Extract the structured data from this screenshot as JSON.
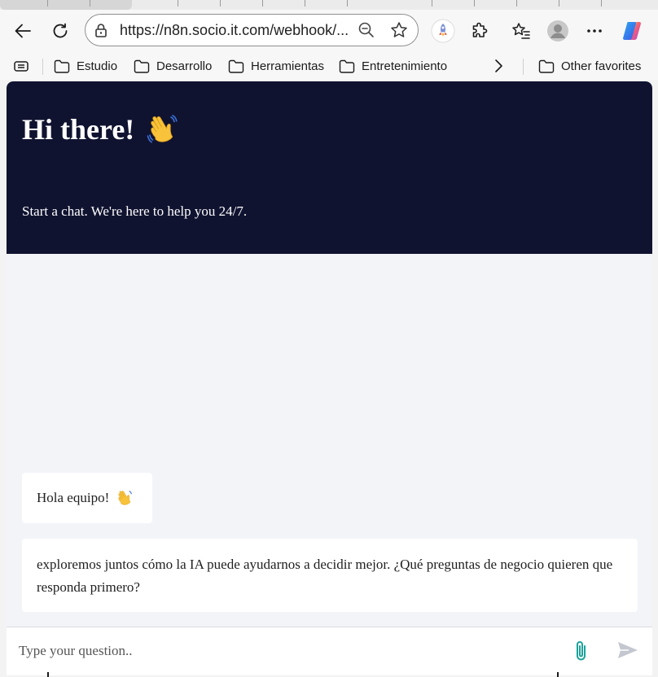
{
  "browser": {
    "address_url": "https://n8n.socio.it.com/webhook/...",
    "favorites": [
      {
        "label": "Estudio"
      },
      {
        "label": "Desarrollo"
      },
      {
        "label": "Herramientas"
      },
      {
        "label": "Entretenimiento"
      }
    ],
    "other_favorites": "Other favorites"
  },
  "chat": {
    "title": "Hi there!",
    "title_emoji": "👋",
    "subtitle": "Start a chat. We're here to help you 24/7.",
    "messages": [
      {
        "text": "Hola equipo!",
        "emoji": "👋"
      },
      {
        "text": "exploremos juntos cómo la IA puede ayudarnos a decidir mejor. ¿Qué preguntas de negocio quieren que responda primero?"
      }
    ],
    "input_placeholder": "Type your question.."
  },
  "colors": {
    "hero_bg": "#101330",
    "chat_bg": "#f2f4f8",
    "attach_icon": "#1aa39a",
    "send_icon": "#c4c7cf"
  }
}
